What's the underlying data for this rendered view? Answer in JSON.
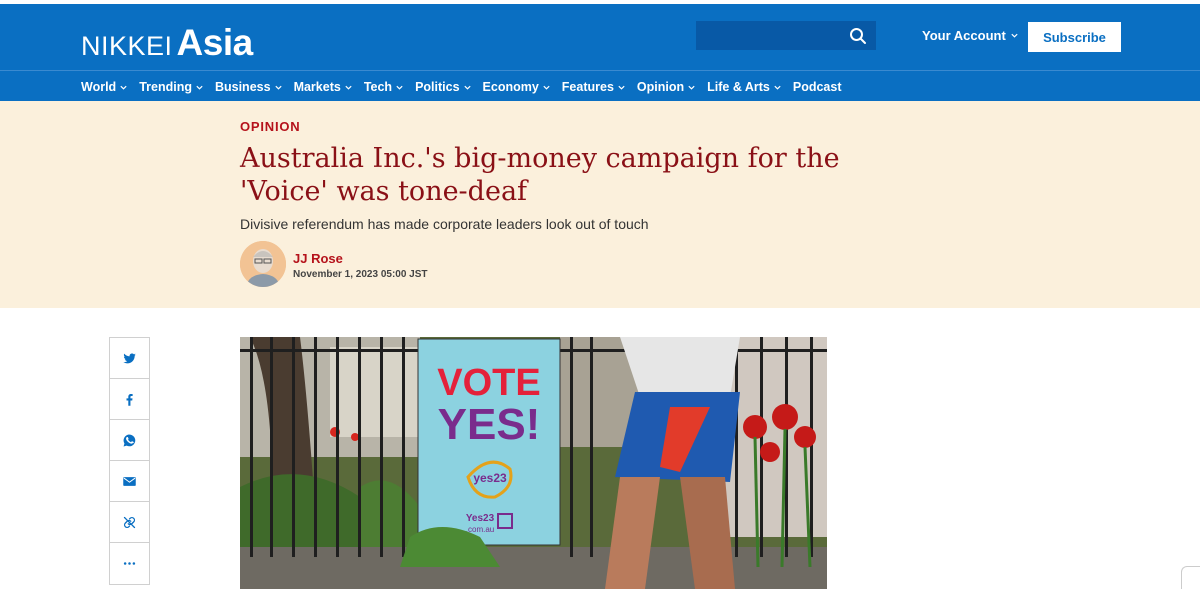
{
  "brand": {
    "nikkei": "NIKKEI",
    "asia": "Asia"
  },
  "search": {
    "placeholder": ""
  },
  "header": {
    "account_label": "Your Account",
    "subscribe_label": "Subscribe"
  },
  "nav": {
    "items": [
      {
        "label": "World",
        "has_dropdown": true
      },
      {
        "label": "Trending",
        "has_dropdown": true
      },
      {
        "label": "Business",
        "has_dropdown": true
      },
      {
        "label": "Markets",
        "has_dropdown": true
      },
      {
        "label": "Tech",
        "has_dropdown": true
      },
      {
        "label": "Politics",
        "has_dropdown": true
      },
      {
        "label": "Economy",
        "has_dropdown": true
      },
      {
        "label": "Features",
        "has_dropdown": true
      },
      {
        "label": "Opinion",
        "has_dropdown": true
      },
      {
        "label": "Life & Arts",
        "has_dropdown": true
      },
      {
        "label": "Podcast",
        "has_dropdown": false
      }
    ]
  },
  "article": {
    "kicker": "OPINION",
    "headline": "Australia Inc.'s big-money campaign for the 'Voice' was tone-deaf",
    "subhead": "Divisive referendum has made corporate leaders look out of touch",
    "author": "JJ Rose",
    "date": "November 1, 2023 05:00 JST"
  },
  "share": {
    "icons": [
      "twitter-icon",
      "facebook-icon",
      "whatsapp-icon",
      "email-icon",
      "link-icon",
      "more-icon"
    ]
  },
  "photo": {
    "sign_line1": "VOTE",
    "sign_line2": "YES!",
    "logo_text": "yes23",
    "url_line1": "Yes23",
    "url_line2": ".com.au"
  },
  "colors": {
    "brand_blue": "#0a6fc2",
    "hero_bg": "#fbf0dc",
    "headline": "#8a1016",
    "accent_red": "#b5121b"
  }
}
